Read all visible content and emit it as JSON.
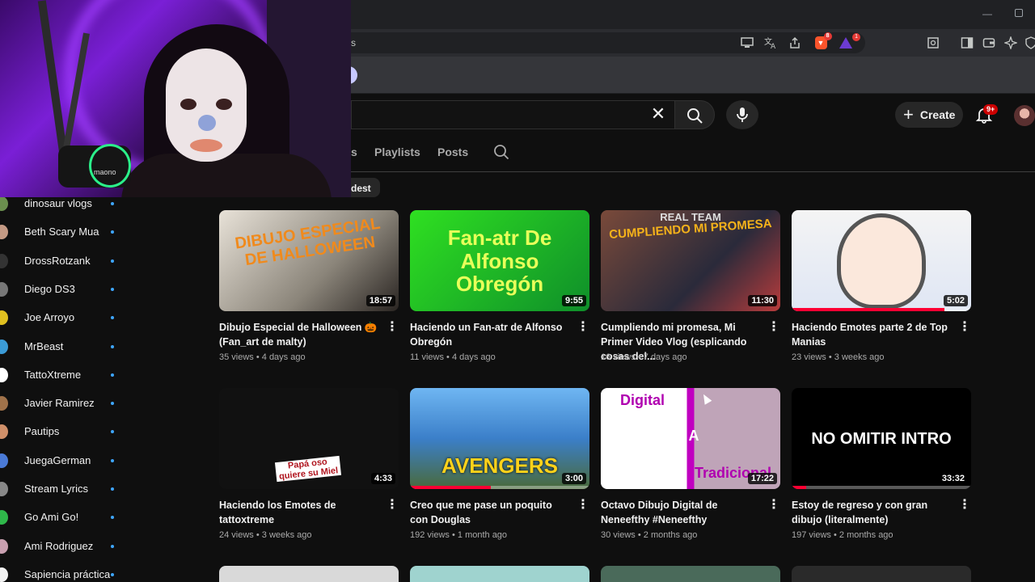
{
  "browser": {
    "url_fragment": "s",
    "toolbar_icons": [
      "cast-icon",
      "translate-icon",
      "share-icon",
      "brave-shields-icon",
      "brave-rewards-icon",
      "screenshot-icon",
      "sidebar-icon",
      "wallet-icon",
      "leo-ai-icon",
      "vpn-icon"
    ],
    "shields_count": "8",
    "rewards_count": "1"
  },
  "header": {
    "clear_symbol": "✕",
    "create_label": "Create",
    "notifications_count": "9+"
  },
  "tabs": {
    "partial": "s",
    "playlists": "Playlists",
    "posts": "Posts",
    "chip": "dest"
  },
  "webcam": {
    "mic_brand": "maono"
  },
  "subscriptions": [
    {
      "name": "dinosaur vlogs",
      "color": "#6a8f4e"
    },
    {
      "name": "Beth Scary Mua",
      "color": "#c49a84"
    },
    {
      "name": "DrossRotzank",
      "color": "#333333"
    },
    {
      "name": "Diego DS3",
      "color": "#777777"
    },
    {
      "name": "Joe Arroyo",
      "color": "#e0c020"
    },
    {
      "name": "MrBeast",
      "color": "#3b9bd6"
    },
    {
      "name": "TattoXtreme",
      "color": "#ffffff"
    },
    {
      "name": "Javier Ramirez",
      "color": "#a0724a"
    },
    {
      "name": "Pautips",
      "color": "#d0906a"
    },
    {
      "name": "JuegaGerman",
      "color": "#4a7ad6"
    },
    {
      "name": "Stream Lyrics",
      "color": "#888888"
    },
    {
      "name": "Go Ami Go!",
      "color": "#2fb84a"
    },
    {
      "name": "Ami Rodriguez",
      "color": "#c9a0b0"
    },
    {
      "name": "Sapiencia práctica",
      "color": "#f2f2f2"
    }
  ],
  "videos": [
    {
      "title": "Dibujo Especial de Halloween 🎃 (Fan_art de malty)",
      "views": "35 views",
      "age": "4 days ago",
      "duration": "18:57",
      "thumb_text": "DIBUJO ESPECIAL DE HALLOWEEN",
      "progress": 0
    },
    {
      "title": "Haciendo un Fan-atr de Alfonso Obregón",
      "views": "11 views",
      "age": "4 days ago",
      "duration": "9:55",
      "thumb_text": "Fan-atr De Alfonso Obregón",
      "progress": 0
    },
    {
      "title": "Cumpliendo mi promesa, Mi Primer Video Vlog (esplicando cosas del...",
      "views": "16 views",
      "age": "7 days ago",
      "duration": "11:30",
      "thumb_text": "CUMPLIENDO MI PROMESA",
      "thumb_caption": "REAL TEAM",
      "progress": 0
    },
    {
      "title": "Haciendo Emotes parte 2 de Top Manias",
      "views": "23 views",
      "age": "3 weeks ago",
      "duration": "5:02",
      "thumb_text": "",
      "progress": 0.85
    },
    {
      "title": "Haciendo los Emotes de tattoxtreme",
      "views": "24 views",
      "age": "3 weeks ago",
      "duration": "4:33",
      "thumb_text": "Papá oso quiere su Miel",
      "progress": 0
    },
    {
      "title": "Creo que me pase un poquito con Douglas",
      "views": "192 views",
      "age": "1 month ago",
      "duration": "3:00",
      "thumb_text": "AVENGERS",
      "progress": 0.45
    },
    {
      "title": "Octavo Dibujo Digital de Neneefthy #Neneefthy",
      "views": "30 views",
      "age": "2 months ago",
      "duration": "17:22",
      "thumb_text": "Digital",
      "thumb_caption": "A",
      "thumb_caption2": "Tradicional",
      "progress": 0
    },
    {
      "title": "Estoy de regreso y con gran dibujo (literalmente)",
      "views": "197 views",
      "age": "2 months ago",
      "duration": "33:32",
      "thumb_text": "NO OMITIR INTRO",
      "progress": 0.08
    }
  ],
  "more_icon": "⋮"
}
